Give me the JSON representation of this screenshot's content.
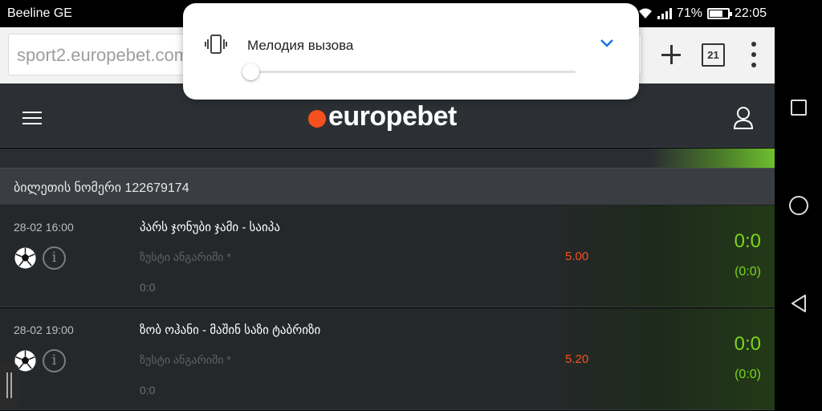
{
  "status_bar": {
    "carrier": "Beeline GE",
    "battery_percent": "71%",
    "battery_level": 0.71,
    "time": "22:05"
  },
  "browser": {
    "url": "sport2.europebet.com",
    "tab_count": "21"
  },
  "site": {
    "logo_text": "europebet",
    "brand_color": "#f4511e"
  },
  "ticket": {
    "label": "ბილეთის ნომერი 122679174"
  },
  "bets": [
    {
      "datetime": "28-02 16:00",
      "match": "პარს ჯონუბი ჯამი - საიპა",
      "market": "ზუსტი ანგარიში *",
      "pick": "0:0",
      "odds": "5.00",
      "score": "0:0",
      "score_sub": "(0:0)"
    },
    {
      "datetime": "28-02 19:00",
      "match": "ზობ ოჰანი - მაშინ საზი ტაბრიზი",
      "market": "ზუსტი ანგარიში *",
      "pick": "0:0",
      "odds": "5.20",
      "score": "0:0",
      "score_sub": "(0:0)"
    }
  ],
  "volume_popup": {
    "label": "Мелодия вызова",
    "level": 0.0
  },
  "colors": {
    "accent_orange": "#f4511e",
    "score_green": "#7ed321",
    "volume_blue": "#1a73e8"
  }
}
